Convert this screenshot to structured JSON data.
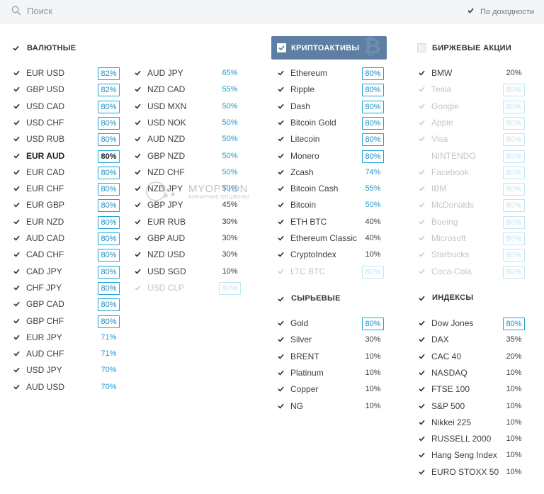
{
  "search": {
    "placeholder": "Поиск"
  },
  "sort": {
    "label": "По доходности",
    "checked": true
  },
  "colors": {
    "accent": "#1fa3d6",
    "header_bg": "#5e7ea3"
  },
  "sections": {
    "currency": {
      "title": "ВАЛЮТНЫЕ",
      "col1": [
        {
          "name": "EUR USD",
          "pct": "82%",
          "style": "boxed"
        },
        {
          "name": "GBP USD",
          "pct": "82%",
          "style": "boxed"
        },
        {
          "name": "USD CAD",
          "pct": "80%",
          "style": "boxed"
        },
        {
          "name": "USD CHF",
          "pct": "80%",
          "style": "boxed"
        },
        {
          "name": "USD RUB",
          "pct": "80%",
          "style": "boxed"
        },
        {
          "name": "EUR AUD",
          "pct": "80%",
          "style": "boxed",
          "bold": true
        },
        {
          "name": "EUR CAD",
          "pct": "80%",
          "style": "boxed"
        },
        {
          "name": "EUR CHF",
          "pct": "80%",
          "style": "boxed"
        },
        {
          "name": "EUR GBP",
          "pct": "80%",
          "style": "boxed"
        },
        {
          "name": "EUR NZD",
          "pct": "80%",
          "style": "boxed"
        },
        {
          "name": "AUD CAD",
          "pct": "80%",
          "style": "boxed"
        },
        {
          "name": "CAD CHF",
          "pct": "80%",
          "style": "boxed"
        },
        {
          "name": "CAD JPY",
          "pct": "80%",
          "style": "boxed"
        },
        {
          "name": "CHF JPY",
          "pct": "80%",
          "style": "boxed"
        },
        {
          "name": "GBP CAD",
          "pct": "80%",
          "style": "boxed"
        },
        {
          "name": "GBP CHF",
          "pct": "80%",
          "style": "boxed"
        },
        {
          "name": "EUR JPY",
          "pct": "71%",
          "style": "blue"
        },
        {
          "name": "AUD CHF",
          "pct": "71%",
          "style": "blue"
        },
        {
          "name": "USD JPY",
          "pct": "70%",
          "style": "blue"
        },
        {
          "name": "AUD USD",
          "pct": "70%",
          "style": "blue"
        }
      ],
      "col2": [
        {
          "name": "AUD JPY",
          "pct": "65%",
          "style": "blue"
        },
        {
          "name": "NZD CAD",
          "pct": "55%",
          "style": "blue"
        },
        {
          "name": "USD MXN",
          "pct": "50%",
          "style": "blue"
        },
        {
          "name": "USD NOK",
          "pct": "50%",
          "style": "blue"
        },
        {
          "name": "AUD NZD",
          "pct": "50%",
          "style": "blue"
        },
        {
          "name": "GBP NZD",
          "pct": "50%",
          "style": "blue"
        },
        {
          "name": "NZD CHF",
          "pct": "50%",
          "style": "blue"
        },
        {
          "name": "NZD JPY",
          "pct": "50%",
          "style": "blue"
        },
        {
          "name": "GBP JPY",
          "pct": "45%",
          "style": "dark"
        },
        {
          "name": "EUR RUB",
          "pct": "30%",
          "style": "dark"
        },
        {
          "name": "GBP AUD",
          "pct": "30%",
          "style": "dark"
        },
        {
          "name": "NZD USD",
          "pct": "30%",
          "style": "dark"
        },
        {
          "name": "USD SGD",
          "pct": "10%",
          "style": "dark"
        },
        {
          "name": "USD CLP",
          "pct": "80%",
          "style": "boxed-dim",
          "disabled": true
        }
      ]
    },
    "crypto": {
      "title": "КРИПТОАКТИВЫ",
      "items": [
        {
          "name": "Ethereum",
          "pct": "80%",
          "style": "boxed"
        },
        {
          "name": "Ripple",
          "pct": "80%",
          "style": "boxed"
        },
        {
          "name": "Dash",
          "pct": "80%",
          "style": "boxed"
        },
        {
          "name": "Bitcoin Gold",
          "pct": "80%",
          "style": "boxed"
        },
        {
          "name": "Litecoin",
          "pct": "80%",
          "style": "boxed"
        },
        {
          "name": "Monero",
          "pct": "80%",
          "style": "boxed"
        },
        {
          "name": "Zcash",
          "pct": "74%",
          "style": "blue"
        },
        {
          "name": "Bitcoin Cash",
          "pct": "55%",
          "style": "blue"
        },
        {
          "name": "Bitcoin",
          "pct": "50%",
          "style": "blue"
        },
        {
          "name": "ETH BTC",
          "pct": "40%",
          "style": "dark"
        },
        {
          "name": "Ethereum Classic",
          "pct": "40%",
          "style": "dark"
        },
        {
          "name": "CryptoIndex",
          "pct": "10%",
          "style": "dark"
        },
        {
          "name": "LTC BTC",
          "pct": "80%",
          "style": "boxed-dim",
          "disabled": true
        }
      ]
    },
    "commodities": {
      "title": "СЫРЬЕВЫЕ",
      "items": [
        {
          "name": "Gold",
          "pct": "80%",
          "style": "boxed"
        },
        {
          "name": "Silver",
          "pct": "30%",
          "style": "dark"
        },
        {
          "name": "BRENT",
          "pct": "10%",
          "style": "dark"
        },
        {
          "name": "Platinum",
          "pct": "10%",
          "style": "dark"
        },
        {
          "name": "Copper",
          "pct": "10%",
          "style": "dark"
        },
        {
          "name": "NG",
          "pct": "10%",
          "style": "dark"
        }
      ]
    },
    "stocks": {
      "title": "БИРЖЕВЫЕ АКЦИИ",
      "items": [
        {
          "name": "BMW",
          "pct": "20%",
          "style": "dark"
        },
        {
          "name": "Tesla",
          "pct": "80%",
          "style": "boxed-dim",
          "disabled": true
        },
        {
          "name": "Google",
          "pct": "80%",
          "style": "boxed-dim",
          "disabled": true
        },
        {
          "name": "Apple",
          "pct": "80%",
          "style": "boxed-dim",
          "disabled": true
        },
        {
          "name": "Visa",
          "pct": "80%",
          "style": "boxed-dim",
          "disabled": true
        },
        {
          "name": "NINTENDO",
          "pct": "80%",
          "style": "boxed-dim",
          "disabled": true,
          "nocheck": true
        },
        {
          "name": "Facebook",
          "pct": "80%",
          "style": "boxed-dim",
          "disabled": true
        },
        {
          "name": "IBM",
          "pct": "80%",
          "style": "boxed-dim",
          "disabled": true
        },
        {
          "name": "McDonalds",
          "pct": "80%",
          "style": "boxed-dim",
          "disabled": true
        },
        {
          "name": "Boeing",
          "pct": "80%",
          "style": "boxed-dim",
          "disabled": true
        },
        {
          "name": "Microsoft",
          "pct": "80%",
          "style": "boxed-dim",
          "disabled": true
        },
        {
          "name": "Starbucks",
          "pct": "80%",
          "style": "boxed-dim",
          "disabled": true
        },
        {
          "name": "Coca-Cola",
          "pct": "80%",
          "style": "boxed-dim",
          "disabled": true
        }
      ]
    },
    "indices": {
      "title": "ИНДЕКСЫ",
      "items": [
        {
          "name": "Dow Jones",
          "pct": "80%",
          "style": "boxed"
        },
        {
          "name": "DAX",
          "pct": "35%",
          "style": "dark"
        },
        {
          "name": "CAC 40",
          "pct": "20%",
          "style": "dark"
        },
        {
          "name": "NASDAQ",
          "pct": "10%",
          "style": "dark"
        },
        {
          "name": "FTSE 100",
          "pct": "10%",
          "style": "dark"
        },
        {
          "name": "S&P 500",
          "pct": "10%",
          "style": "dark"
        },
        {
          "name": "Nikkei 225",
          "pct": "10%",
          "style": "dark"
        },
        {
          "name": "RUSSELL 2000",
          "pct": "10%",
          "style": "dark"
        },
        {
          "name": "Hang Seng Index",
          "pct": "10%",
          "style": "dark"
        },
        {
          "name": "EURO STOXX 50",
          "pct": "10%",
          "style": "dark"
        }
      ]
    }
  },
  "watermark": {
    "brand": "MYOPTION",
    "tagline": "БИНАРНЫЕ ОПЦИОНЫ"
  }
}
